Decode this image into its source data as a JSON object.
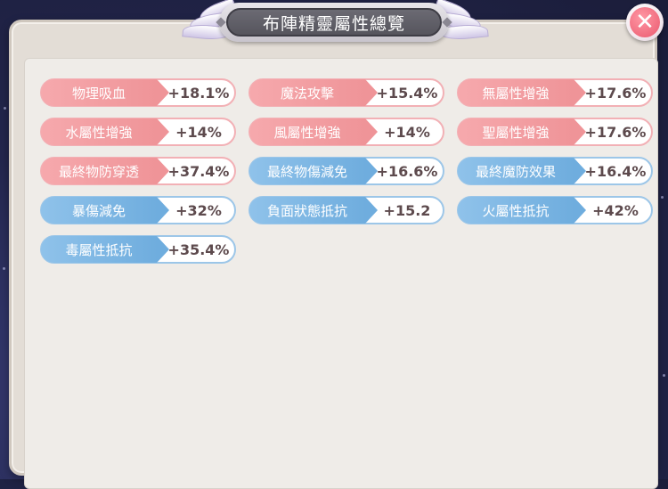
{
  "dialog": {
    "title": "布陣精靈屬性總覽",
    "close_symbol": "✕",
    "close_icon": "close-icon"
  },
  "colors": {
    "red_label": "#ef9498",
    "blue_label": "#6fadde",
    "panel": "#e3ddd6",
    "close": "#f06b7e"
  },
  "stats": [
    {
      "label": "物理吸血",
      "value": "+18.1%",
      "color": "red"
    },
    {
      "label": "魔法攻擊",
      "value": "+15.4%",
      "color": "red"
    },
    {
      "label": "無屬性增強",
      "value": "+17.6%",
      "color": "red"
    },
    {
      "label": "水屬性增強",
      "value": "+14%",
      "color": "red"
    },
    {
      "label": "風屬性增強",
      "value": "+14%",
      "color": "red"
    },
    {
      "label": "聖屬性增強",
      "value": "+17.6%",
      "color": "red"
    },
    {
      "label": "最終物防穿透",
      "value": "+37.4%",
      "color": "red"
    },
    {
      "label": "最終物傷減免",
      "value": "+16.6%",
      "color": "blue"
    },
    {
      "label": "最終魔防效果",
      "value": "+16.4%",
      "color": "blue"
    },
    {
      "label": "暴傷減免",
      "value": "+32%",
      "color": "blue"
    },
    {
      "label": "負面狀態抵抗",
      "value": "+15.2",
      "color": "blue"
    },
    {
      "label": "火屬性抵抗",
      "value": "+42%",
      "color": "blue"
    },
    {
      "label": "毒屬性抵抗",
      "value": "+35.4%",
      "color": "blue"
    }
  ]
}
